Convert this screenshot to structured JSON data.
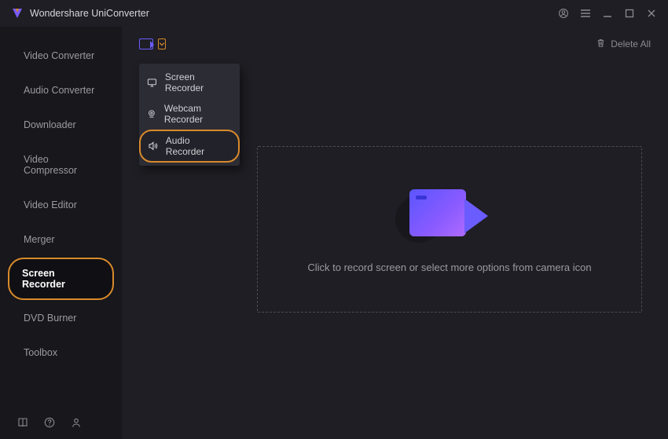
{
  "app": {
    "title": "Wondershare UniConverter"
  },
  "sidebar": {
    "items": [
      {
        "label": "Video Converter"
      },
      {
        "label": "Audio Converter"
      },
      {
        "label": "Downloader"
      },
      {
        "label": "Video Compressor"
      },
      {
        "label": "Video Editor"
      },
      {
        "label": "Merger"
      },
      {
        "label": "Screen Recorder"
      },
      {
        "label": "DVD Burner"
      },
      {
        "label": "Toolbox"
      }
    ]
  },
  "toolbar": {
    "delete_all": "Delete All",
    "dropdown": [
      {
        "label": "Screen Recorder"
      },
      {
        "label": "Webcam Recorder"
      },
      {
        "label": "Audio Recorder"
      }
    ]
  },
  "dropzone": {
    "hint": "Click to record screen or select more options from camera icon"
  }
}
